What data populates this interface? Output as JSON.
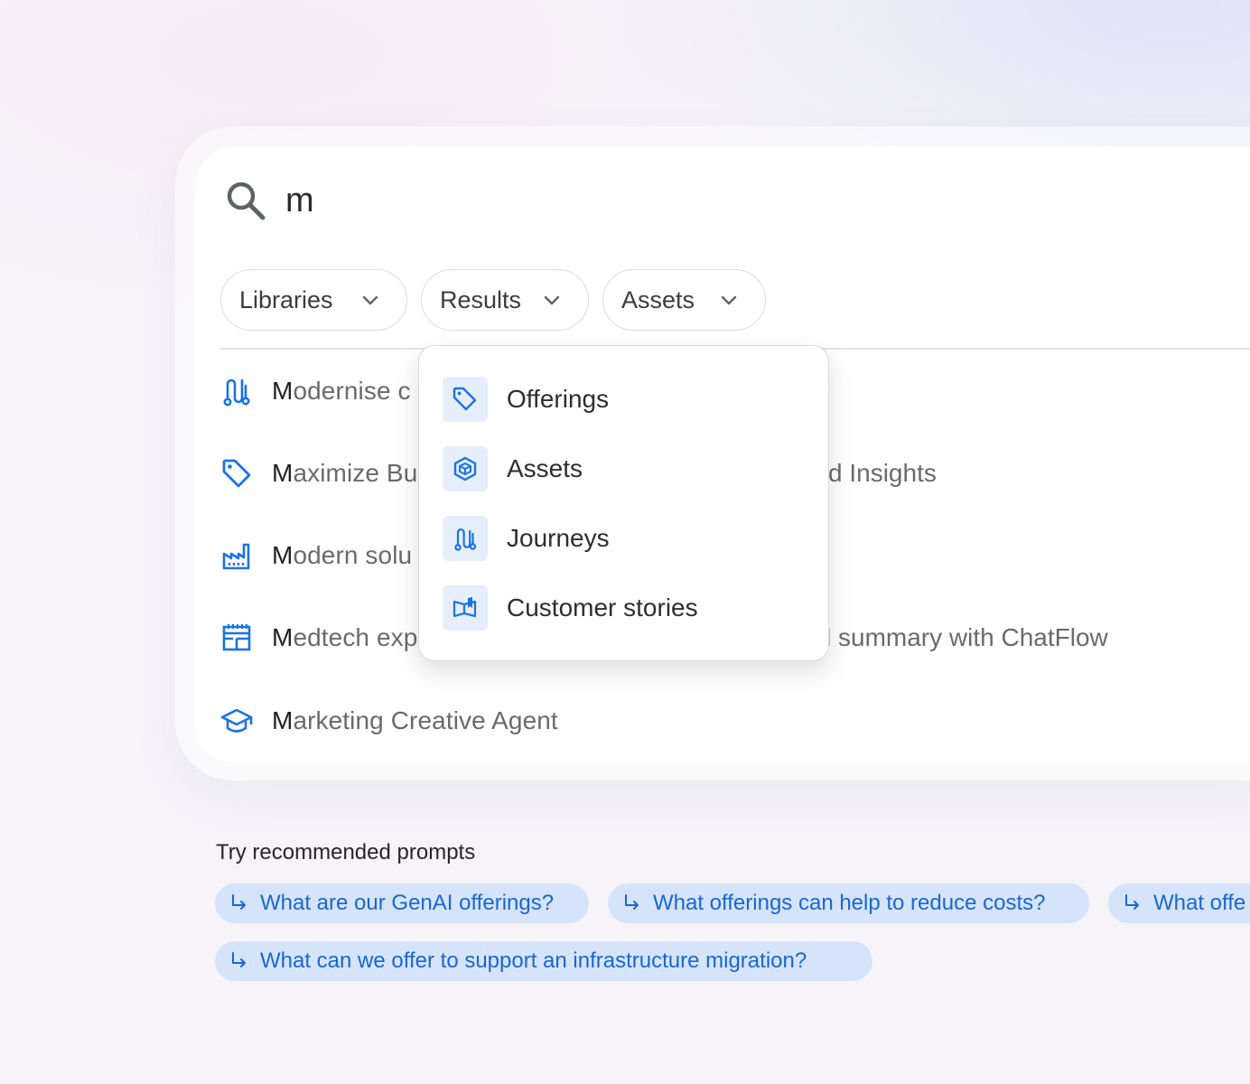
{
  "search": {
    "query": "m",
    "icon": "search-icon"
  },
  "filters": [
    {
      "label": "Libraries",
      "icon": "chevron-down-icon"
    },
    {
      "label": "Results",
      "icon": "chevron-down-icon"
    },
    {
      "label": "Assets",
      "icon": "chevron-down-icon"
    }
  ],
  "results": [
    {
      "icon": "journey-icon",
      "highlight": "M",
      "rest_visible_left": "odernise c",
      "rest_visible_right": ""
    },
    {
      "icon": "tag-icon",
      "highlight": "M",
      "rest_visible_left": "aximize Bu",
      "rest_visible_right": "d Insights"
    },
    {
      "icon": "factory-icon",
      "highlight": "M",
      "rest_visible_left": "odern solu",
      "rest_visible_right": ""
    },
    {
      "icon": "calendar-layout-icon",
      "highlight": "M",
      "rest_visible_left": "edtech exp",
      "rest_visible_right": "l summary with ChatFlow"
    },
    {
      "icon": "school-cap-icon",
      "highlight": "M",
      "rest_visible_left": "arketing Creative Agent",
      "rest_visible_right": ""
    }
  ],
  "dropdown": {
    "items": [
      {
        "label": "Offerings",
        "icon": "tag-icon"
      },
      {
        "label": "Assets",
        "icon": "cube-icon"
      },
      {
        "label": "Journeys",
        "icon": "journey-icon"
      },
      {
        "label": "Customer stories",
        "icon": "book-icon"
      }
    ]
  },
  "prompts": {
    "heading": "Try recommended prompts",
    "items": [
      "What are our GenAI offerings?",
      "What offerings can help to reduce costs?",
      "What offe",
      "What can we offer to support an infrastructure migration?"
    ]
  },
  "colors": {
    "accent": "#1a73e8",
    "chip_bg": "#d6e4fb",
    "tile_bg": "#e6eefb"
  }
}
